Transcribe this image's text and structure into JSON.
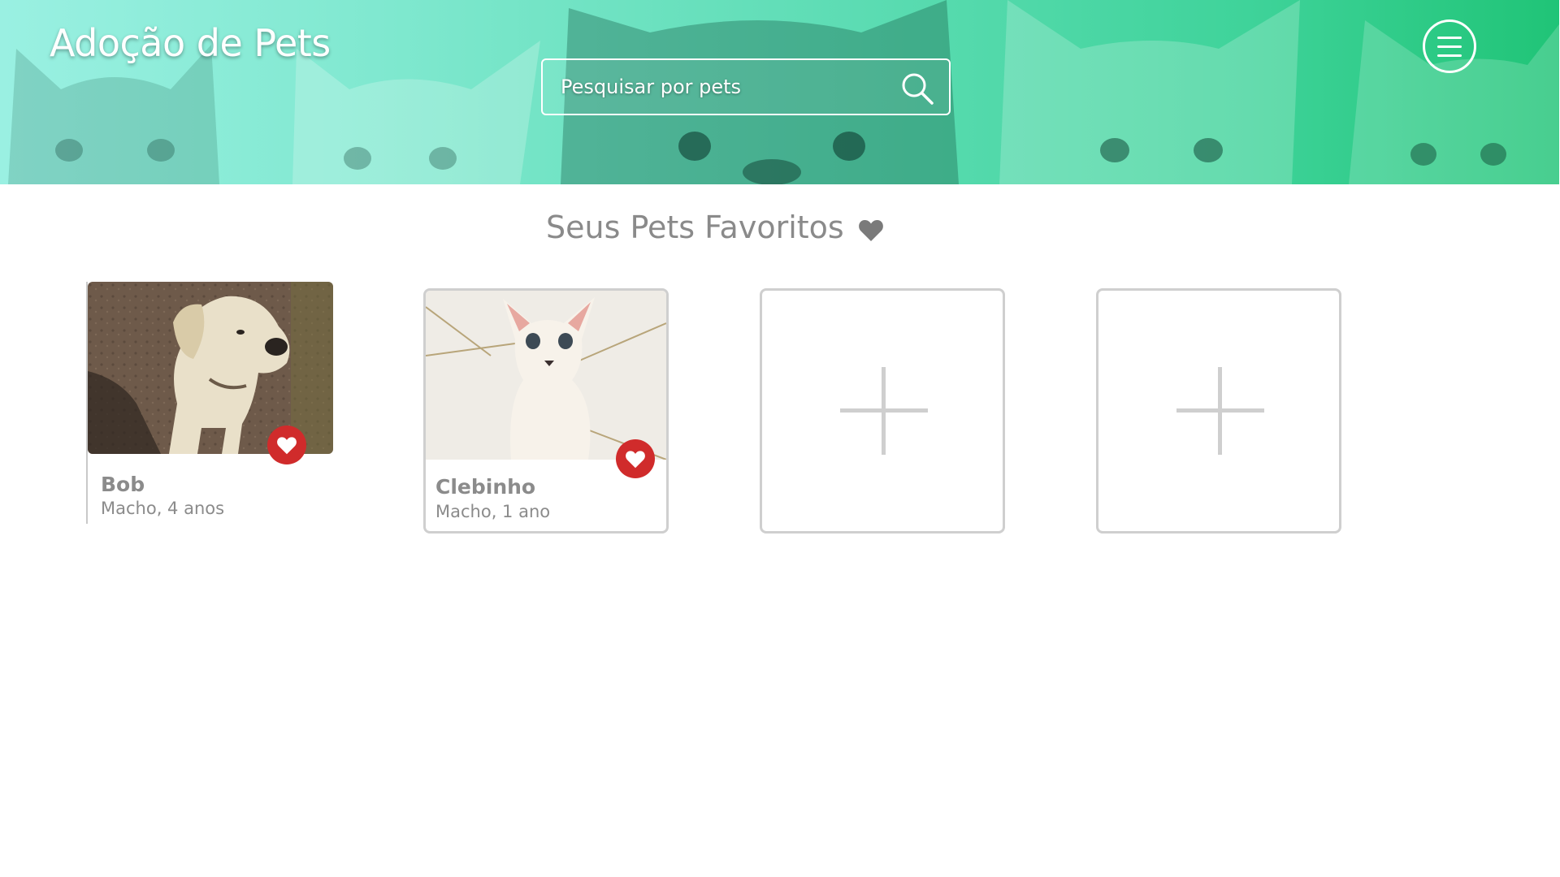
{
  "header": {
    "title": "Adoção de Pets",
    "search": {
      "placeholder": "Pesquisar por pets",
      "value": ""
    },
    "search_icon": "search-icon",
    "menu_icon": "hamburger-menu-icon"
  },
  "favorites": {
    "title": "Seus Pets Favoritos",
    "title_icon": "heart-icon",
    "pets": [
      {
        "name": "Bob",
        "info": "Macho, 4 anos",
        "favorite_icon": "heart-icon"
      },
      {
        "name": "Clebinho",
        "info": "Macho, 1 ano",
        "favorite_icon": "heart-icon"
      }
    ],
    "empty_slot_icon": "plus-icon"
  },
  "colors": {
    "header_gradient_start": "#9af0e2",
    "header_gradient_end": "#20c477",
    "favorite_red": "#d02b2b",
    "text_gray": "#8a8a8a",
    "border_gray": "#cfcfcf"
  }
}
